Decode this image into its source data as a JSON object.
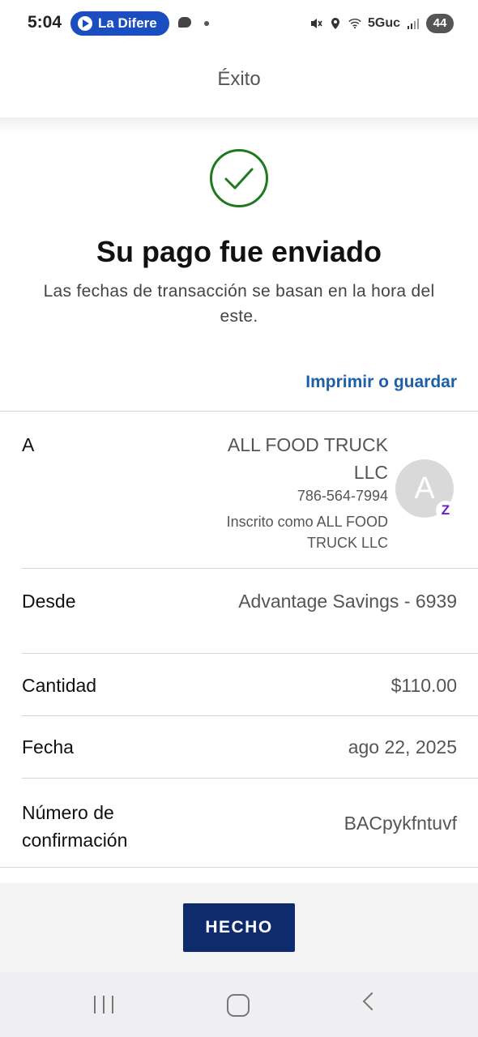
{
  "status_bar": {
    "time": "5:04",
    "notification_label": "La Difere",
    "network": "5Guc",
    "battery": "44"
  },
  "header": {
    "title": "Éxito"
  },
  "confirmation": {
    "title": "Su pago fue enviado",
    "subtitle": "Las fechas de transacción se basan en la hora del este.",
    "print_link": "Imprimir o guardar"
  },
  "details": {
    "to": {
      "label": "A",
      "name": "ALL FOOD TRUCK LLC",
      "phone": "786-564-7994",
      "enrolled": "Inscrito como ALL FOOD TRUCK LLC",
      "avatar_initial": "A",
      "badge": "Z"
    },
    "from": {
      "label": "Desde",
      "value": "Advantage Savings - 6939"
    },
    "amount": {
      "label": "Cantidad",
      "value": "$110.00"
    },
    "date": {
      "label": "Fecha",
      "value": "ago 22, 2025"
    },
    "confirmation_number": {
      "label": "Número de confirmación",
      "value": "BACpykfntuvf"
    }
  },
  "actions": {
    "done_label": "HECHO"
  },
  "colors": {
    "success_green": "#1f7a1f",
    "link_blue": "#1d5fa8",
    "button_navy": "#0e2b6e",
    "zelle_purple": "#6c1cd3"
  }
}
